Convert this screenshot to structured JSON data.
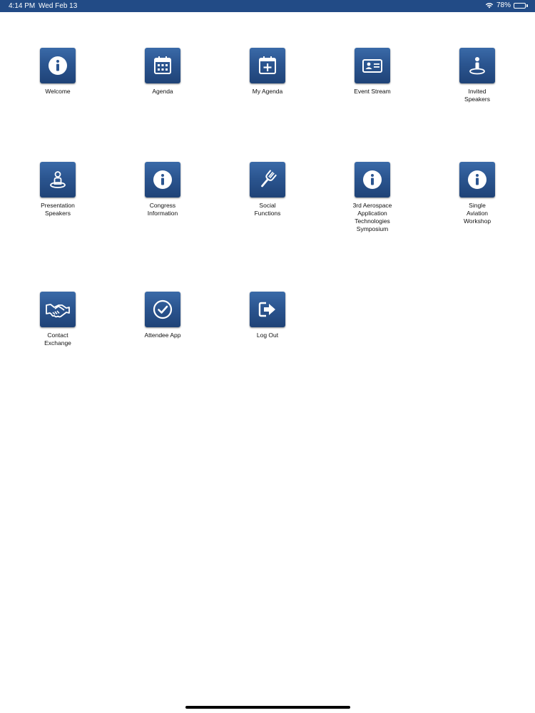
{
  "status_bar": {
    "time": "4:14 PM",
    "date": "Wed Feb 13",
    "battery_percent": "78%",
    "battery_level": 0.78
  },
  "tiles": [
    {
      "label": "Welcome",
      "icon": "info-icon"
    },
    {
      "label": "Agenda",
      "icon": "calendar-icon"
    },
    {
      "label": "My Agenda",
      "icon": "calendar-add-icon"
    },
    {
      "label": "Event Stream",
      "icon": "id-card-icon"
    },
    {
      "label": "Invited\nSpeakers",
      "icon": "speaker-icon"
    },
    {
      "label": "Presentation\nSpeakers",
      "icon": "presenter-icon"
    },
    {
      "label": "Congress\nInformation",
      "icon": "info-icon"
    },
    {
      "label": "Social\nFunctions",
      "icon": "fork-icon"
    },
    {
      "label": "3rd Aerospace\nApplication\nTechnologies\nSymposium",
      "icon": "info-icon"
    },
    {
      "label": "Single\nAviation\nWorkshop",
      "icon": "info-icon"
    },
    {
      "label": "Contact\nExchange",
      "icon": "handshake-icon"
    },
    {
      "label": "Attendee App",
      "icon": "checkmark-circle-icon"
    },
    {
      "label": "Log Out",
      "icon": "logout-icon"
    }
  ],
  "colors": {
    "status_bar": "#224b86",
    "tile_top": "#3a6aa8",
    "tile_bottom": "#1f4377"
  }
}
